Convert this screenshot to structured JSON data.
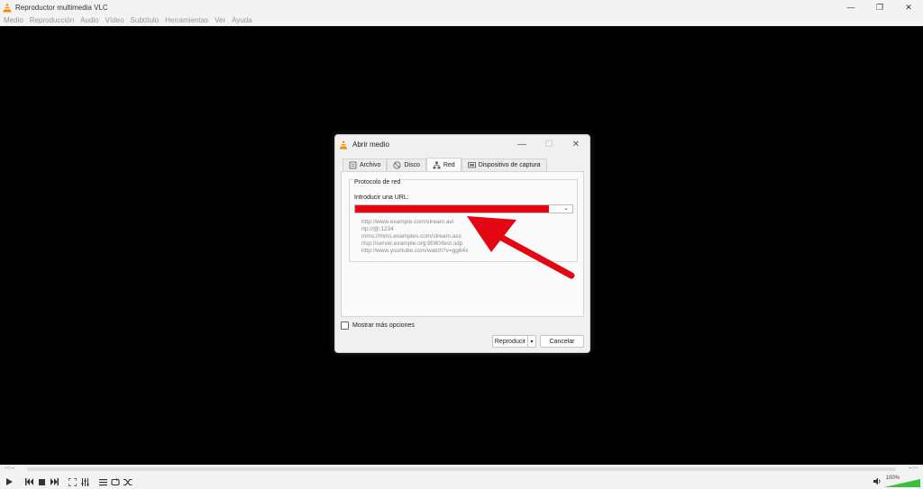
{
  "window": {
    "title": "Reproductor multimedia VLC",
    "minimize": "—",
    "maximize": "❐",
    "close": "✕"
  },
  "menu": [
    "Medio",
    "Reproducción",
    "Audio",
    "Vídeo",
    "Subtítulo",
    "Herramientas",
    "Ver",
    "Ayuda"
  ],
  "dialog": {
    "title": "Abrir medio",
    "minimize": "—",
    "maximize": "☐",
    "close": "✕",
    "tabs": [
      {
        "label": "Archivo",
        "icon": "file-icon"
      },
      {
        "label": "Disco",
        "icon": "disc-icon"
      },
      {
        "label": "Red",
        "icon": "network-icon"
      },
      {
        "label": "Dispositivo de captura",
        "icon": "capture-device-icon"
      }
    ],
    "active_tab": "Red",
    "group_title": "Protocolo de red",
    "url_label": "Introducir una URL:",
    "url_value": "",
    "examples": [
      "http://www.example.com/stream.avi",
      "rtp://@:1234",
      "mms://mms.examples.com/stream.asx",
      "rtsp://server.example.org:8080/test.sdp",
      "http://www.yourtube.com/watch?v=gg64x"
    ],
    "show_more_label": "Mostrar más opciones",
    "show_more_checked": false,
    "play_label": "Reproducir",
    "play_dropdown": "▾",
    "cancel_label": "Cancelar"
  },
  "annotation": {
    "color": "#e30613"
  },
  "player": {
    "time_elapsed": "--:--",
    "time_total": "--:--",
    "volume": "100%",
    "volume_level": 1.0
  }
}
